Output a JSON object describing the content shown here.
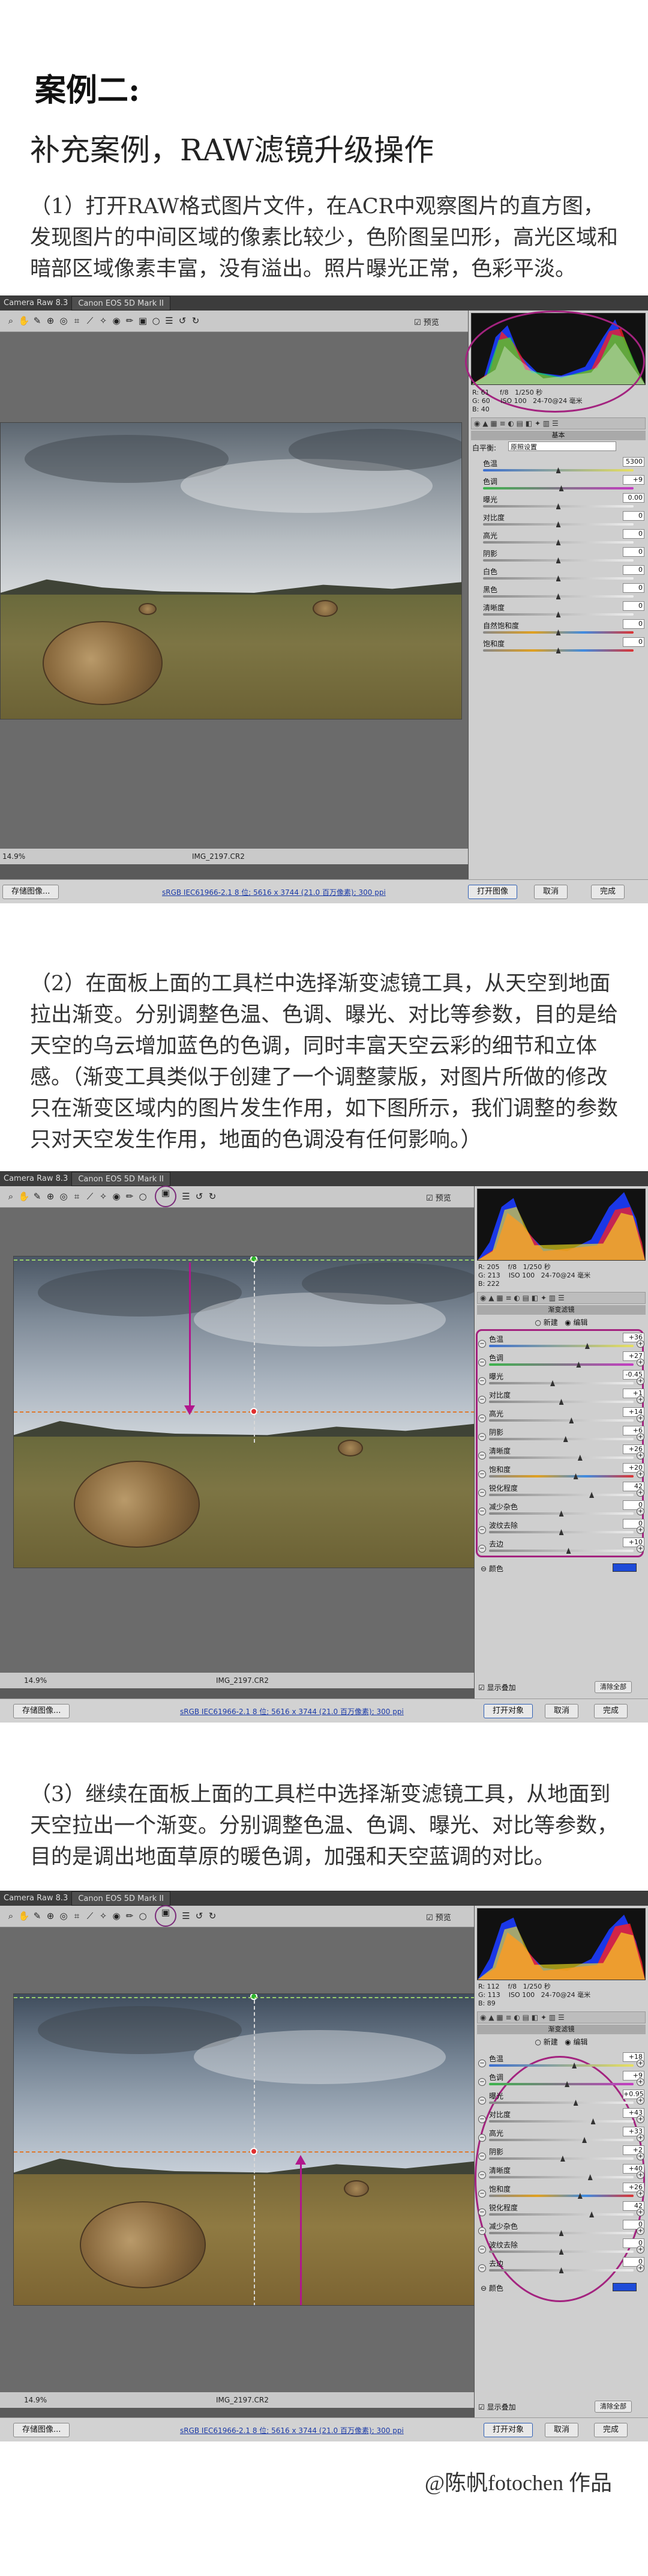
{
  "title": "案例二:",
  "subtitle": "补充案例，RAW滤镜升级操作",
  "steps": [
    {
      "text": "（1）打开RAW格式图片文件，在ACR中观察图片的直方图，发现图片的中间区域的像素比较少，色阶图呈凹形，高光区域和暗部区域像素丰富，没有溢出。照片曝光正常，色彩平淡。"
    },
    {
      "text": "（2）在面板上面的工具栏中选择渐变滤镜工具，从天空到地面拉出渐变。分别调整色温、色调、曝光、对比等参数，目的是给天空的乌云增加蓝色的色调，同时丰富天空云彩的细节和立体感。（渐变工具类似于创建了一个调整蒙版，对图片所做的修改只在渐变区域内的图片发生作用，如下图所示，我们调整的参数只对天空发生作用，地面的色调没有任何影响。）"
    },
    {
      "text": "（3）继续在面板上面的工具栏中选择渐变滤镜工具，从地面到天空拉出一个渐变。分别调整色温、色调、曝光、对比等参数，目的是调出地面草原的暖色调，加强和天空蓝调的对比。"
    }
  ],
  "credit": "@陈帆fotochen 作品",
  "acr": {
    "window_title": "Camera Raw 8.3",
    "camera_tab": "Canon EOS 5D Mark II",
    "preview_label": "预览",
    "filename": "IMG_2197.CR2",
    "workflow_link": "sRGB IEC61966-2.1 8 位; 5616 x 3744 (21.0 百万像素); 300 ppi",
    "zoom": "14.9%",
    "btn_save": "存储图像...",
    "btn_open": "打开对象",
    "btn_cancel": "取消",
    "btn_done": "完成",
    "btn_open_image": "打开图像",
    "btn_reset": "清除全部",
    "show_overlay": "显示叠加",
    "color_label": "颜色",
    "mode_new": "新建",
    "mode_edit": "编辑",
    "grad_head": "渐变滤镜",
    "basic_head": "基本",
    "exif1": {
      "r": "R: 61",
      "g": "G: 60",
      "b": "B: 40",
      "f": "f/8",
      "shutter": "1/250 秒",
      "iso": "ISO 100",
      "lens": "24-70@24 毫米"
    },
    "exif2": {
      "r": "R: 205",
      "g": "G: 213",
      "b": "B: 222",
      "f": "f/8",
      "shutter": "1/250 秒",
      "iso": "ISO 100",
      "lens": "24-70@24 毫米"
    },
    "exif3": {
      "r": "R: 112",
      "g": "G: 113",
      "b": "B: 89",
      "f": "f/8",
      "shutter": "1/250 秒",
      "iso": "ISO 100",
      "lens": "24-70@24 毫米"
    },
    "basic": {
      "wb_label": "白平衡:",
      "wb_value": "原照设置",
      "auto": "自动",
      "default": "默认值",
      "rows": [
        {
          "label": "色温",
          "value": "5300",
          "pos": 0.5,
          "kind": "temp"
        },
        {
          "label": "色调",
          "value": "+9",
          "pos": 0.52,
          "kind": "tint"
        },
        {
          "label": "曝光",
          "value": "0.00",
          "pos": 0.5,
          "kind": "plain"
        },
        {
          "label": "对比度",
          "value": "0",
          "pos": 0.5,
          "kind": "plain"
        },
        {
          "label": "高光",
          "value": "0",
          "pos": 0.5,
          "kind": "plain"
        },
        {
          "label": "阴影",
          "value": "0",
          "pos": 0.5,
          "kind": "plain"
        },
        {
          "label": "白色",
          "value": "0",
          "pos": 0.5,
          "kind": "plain"
        },
        {
          "label": "黑色",
          "value": "0",
          "pos": 0.5,
          "kind": "plain"
        },
        {
          "label": "清晰度",
          "value": "0",
          "pos": 0.5,
          "kind": "plain"
        },
        {
          "label": "自然饱和度",
          "value": "0",
          "pos": 0.5,
          "kind": "sat"
        },
        {
          "label": "饱和度",
          "value": "0",
          "pos": 0.5,
          "kind": "sat"
        }
      ]
    },
    "grad2": [
      {
        "label": "色温",
        "value": "+36",
        "pos": 0.68
      },
      {
        "label": "色调",
        "value": "+27",
        "pos": 0.62
      },
      {
        "label": "曝光",
        "value": "-0.45",
        "pos": 0.44
      },
      {
        "label": "对比度",
        "value": "+1",
        "pos": 0.5
      },
      {
        "label": "高光",
        "value": "+14",
        "pos": 0.57
      },
      {
        "label": "阴影",
        "value": "+6",
        "pos": 0.53
      },
      {
        "label": "清晰度",
        "value": "+26",
        "pos": 0.63
      },
      {
        "label": "饱和度",
        "value": "+20",
        "pos": 0.6
      },
      {
        "label": "锐化程度",
        "value": "42",
        "pos": 0.71
      },
      {
        "label": "减少杂色",
        "value": "0",
        "pos": 0.5
      },
      {
        "label": "波纹去除",
        "value": "0",
        "pos": 0.5
      },
      {
        "label": "去边",
        "value": "+10",
        "pos": 0.55
      }
    ],
    "grad3": [
      {
        "label": "色温",
        "value": "+18",
        "pos": 0.59
      },
      {
        "label": "色调",
        "value": "+9",
        "pos": 0.54
      },
      {
        "label": "曝光",
        "value": "+0.95",
        "pos": 0.6
      },
      {
        "label": "对比度",
        "value": "+43",
        "pos": 0.72
      },
      {
        "label": "高光",
        "value": "+33",
        "pos": 0.66
      },
      {
        "label": "阴影",
        "value": "+2",
        "pos": 0.51
      },
      {
        "label": "清晰度",
        "value": "+40",
        "pos": 0.7
      },
      {
        "label": "饱和度",
        "value": "+26",
        "pos": 0.63
      },
      {
        "label": "锐化程度",
        "value": "42",
        "pos": 0.71
      },
      {
        "label": "减少杂色",
        "value": "0",
        "pos": 0.5
      },
      {
        "label": "波纹去除",
        "value": "0",
        "pos": 0.5
      },
      {
        "label": "去边",
        "value": "0",
        "pos": 0.5
      }
    ]
  }
}
